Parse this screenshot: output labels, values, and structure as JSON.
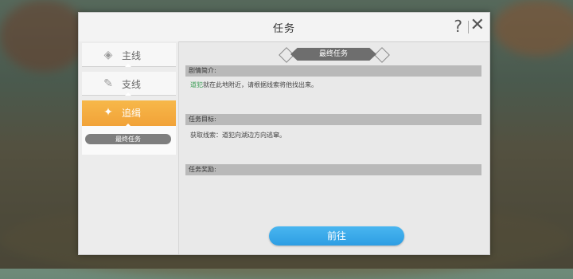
{
  "dialog": {
    "title": "任务",
    "help_icon": "?",
    "close_icon": "✕"
  },
  "sidebar": {
    "tabs": [
      {
        "label": "主线",
        "icon": "main-quest-icon",
        "active": false
      },
      {
        "label": "支线",
        "icon": "side-quest-icon",
        "active": false
      },
      {
        "label": "追缉",
        "icon": "pursuit-icon",
        "active": true
      }
    ],
    "subtab_label": "最终任务"
  },
  "content": {
    "banner": "最终任务",
    "story": {
      "header": "剧情简介:",
      "npc": "道犯",
      "text": "就在此地附近，请根据线索将他找出来。"
    },
    "objective": {
      "header": "任务目标:",
      "text": "获取线索：道犯向湖边方向逃窜。"
    },
    "reward": {
      "header": "任务奖励:"
    },
    "go_button": "前往"
  },
  "colors": {
    "active_tab": "#f1a238",
    "go_button": "#2d9de3",
    "npc_name": "#3f9f58"
  }
}
